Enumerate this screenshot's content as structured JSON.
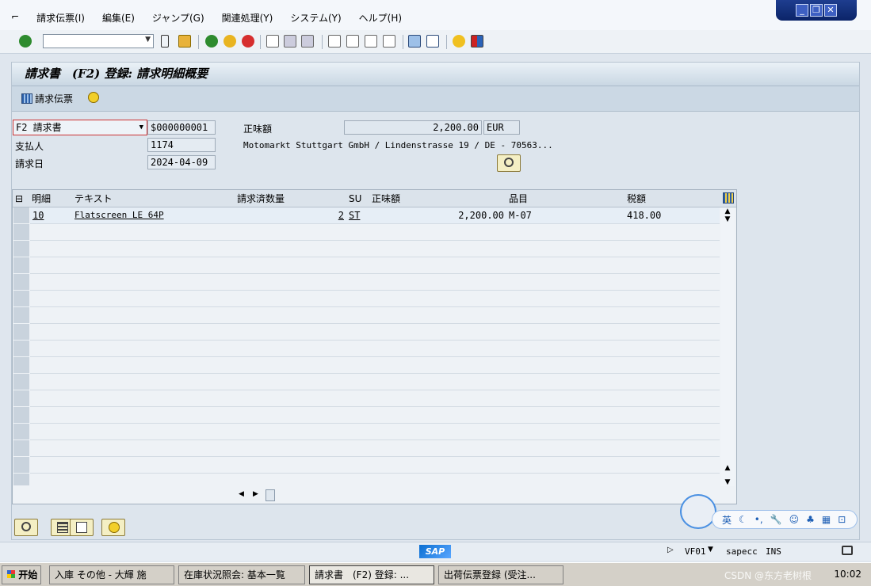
{
  "menu": [
    "請求伝票(I)",
    "編集(E)",
    "ジャンプ(G)",
    "関連処理(Y)",
    "システム(Y)",
    "ヘルプ(H)"
  ],
  "toolbar": {
    "command_field": ""
  },
  "screen": {
    "title": "請求書　(F2) 登録: 請求明細概要",
    "app_button_label": "請求伝票"
  },
  "header": {
    "doc_type": "F2 請求書",
    "doc_number": "$000000001",
    "payer_label": "支払人",
    "payer_value": "1174",
    "date_label": "請求日",
    "date_value": "2024-04-09",
    "net_label": "正味額",
    "net_value": "2,200.00",
    "currency": "EUR",
    "address": "Motomarkt Stuttgart GmbH / Lindenstrasse 19 / DE - 70563..."
  },
  "table": {
    "headers": [
      "明細",
      "テキスト",
      "請求済数量",
      "SU",
      "正味額",
      "品目",
      "税額"
    ],
    "rows": [
      {
        "item": "10",
        "text": "Flatscreen LE 64P",
        "qty": "2",
        "su": "ST",
        "net": "2,200.00",
        "material": "M-07",
        "tax": "418.00"
      }
    ]
  },
  "status": {
    "sap_logo": "SAP",
    "tcode": "VF01",
    "server": "sapecc",
    "mode": "INS"
  },
  "taskbar": {
    "start": "开始",
    "tasks": [
      "入庫 その他 - 大輝 施",
      "在庫状況照会: 基本一覧",
      "請求書　(F2) 登録: ...",
      "出荷伝票登録 (受注..."
    ],
    "clock": "10:02",
    "watermark": "CSDN @东方老树根"
  },
  "ime": {
    "mode": "英"
  },
  "colors": {
    "accent": "#1e3d8f",
    "sap_blue": "#0a6ed1"
  }
}
